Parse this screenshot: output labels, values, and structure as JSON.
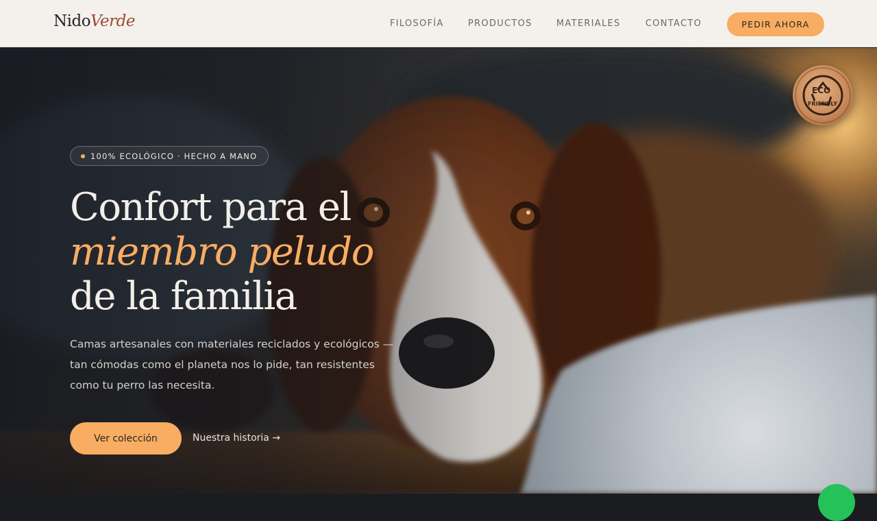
{
  "brand": {
    "name": "Nido",
    "accent": "Verde"
  },
  "nav": {
    "items": [
      {
        "label": "FILOSOFÍA"
      },
      {
        "label": "PRODUCTOS"
      },
      {
        "label": "MATERIALES"
      },
      {
        "label": "CONTACTO"
      }
    ],
    "cta_label": "PEDIR AHORA"
  },
  "badge": {
    "top": "ECO",
    "bottom": "FRIENDLY",
    "icon": "recycle-icon"
  },
  "hero": {
    "pill_text": "100% ECOLÓGICO · HECHO A MANO",
    "headline": {
      "line1": "Confort para el",
      "line2": "miembro peludo",
      "line3": "de la familia"
    },
    "subtext": "Camas artesanales con materiales reciclados y ecológicos — tan cómodas como el planeta nos lo pide, tan resistentes como tu perro las necesita.",
    "primary_button": "Ver colección",
    "secondary_link": "Nuestra historia →",
    "background_image": "beagle-lying-on-blanket"
  },
  "colors": {
    "accent": "#f8ad63",
    "header_bg": "#f4f1ec",
    "brand_accent": "#9c4a32",
    "chat_green": "#25c25a"
  }
}
